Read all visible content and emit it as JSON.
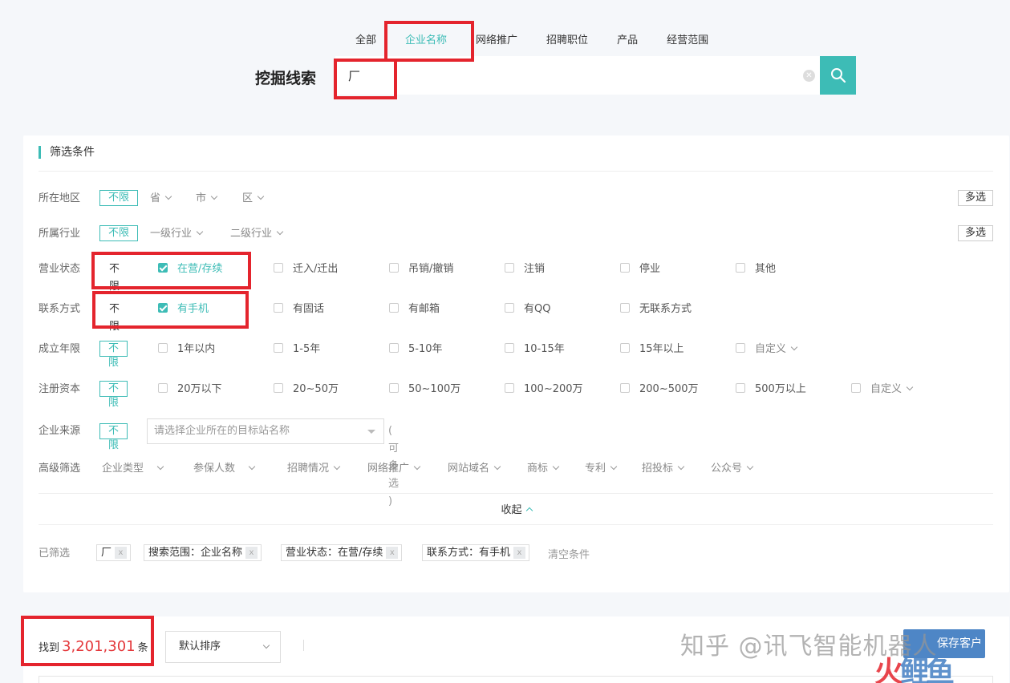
{
  "tabs": [
    "全部",
    "企业名称",
    "网络推广",
    "招聘职位",
    "产品",
    "经营范围"
  ],
  "active_tab": "企业名称",
  "search": {
    "title": "挖掘线索",
    "value": "厂"
  },
  "filter": {
    "title": "筛选条件",
    "multi_label": "多选",
    "unlimited": "不限",
    "region": {
      "label": "所在地区",
      "dropdowns": [
        "省",
        "市",
        "区"
      ]
    },
    "industry": {
      "label": "所属行业",
      "dropdowns": [
        "一级行业",
        "二级行业"
      ]
    },
    "business_status": {
      "label": "营业状态",
      "options": [
        "在营/存续",
        "迁入/迁出",
        "吊销/撤销",
        "注销",
        "停业",
        "其他"
      ]
    },
    "contact": {
      "label": "联系方式",
      "options": [
        "有手机",
        "有固话",
        "有邮箱",
        "有QQ",
        "无联系方式"
      ]
    },
    "founded": {
      "label": "成立年限",
      "options": [
        "1年以内",
        "1-5年",
        "5-10年",
        "10-15年",
        "15年以上"
      ],
      "custom": "自定义"
    },
    "capital": {
      "label": "注册资本",
      "options": [
        "20万以下",
        "20~50万",
        "50~100万",
        "100~200万",
        "200~500万",
        "500万以上"
      ],
      "custom": "自定义"
    },
    "source": {
      "label": "企业来源",
      "placeholder": "请选择企业所在的目标站名称",
      "hint": "( 可多选 )"
    },
    "advanced": {
      "label": "高级筛选",
      "items": [
        "企业类型",
        "参保人数",
        "招聘情况",
        "网络推广",
        "网站域名",
        "商标",
        "专利",
        "招投标",
        "公众号"
      ]
    },
    "collapse": "收起"
  },
  "selected": {
    "label": "已筛选",
    "chips": [
      "厂",
      "搜索范围：企业名称",
      "营业状态：在营/存续",
      "联系方式：有手机"
    ],
    "chip_close": "x",
    "clear": "清空条件"
  },
  "results": {
    "found_prefix": "找到",
    "count": "3,201,301",
    "found_suffix": "条",
    "sort": "默认排序",
    "save_button": "保存客户"
  },
  "watermark": {
    "text": "知乎 @讯飞智能机器人",
    "brand_a": "火",
    "brand_b": "鲤鱼"
  }
}
